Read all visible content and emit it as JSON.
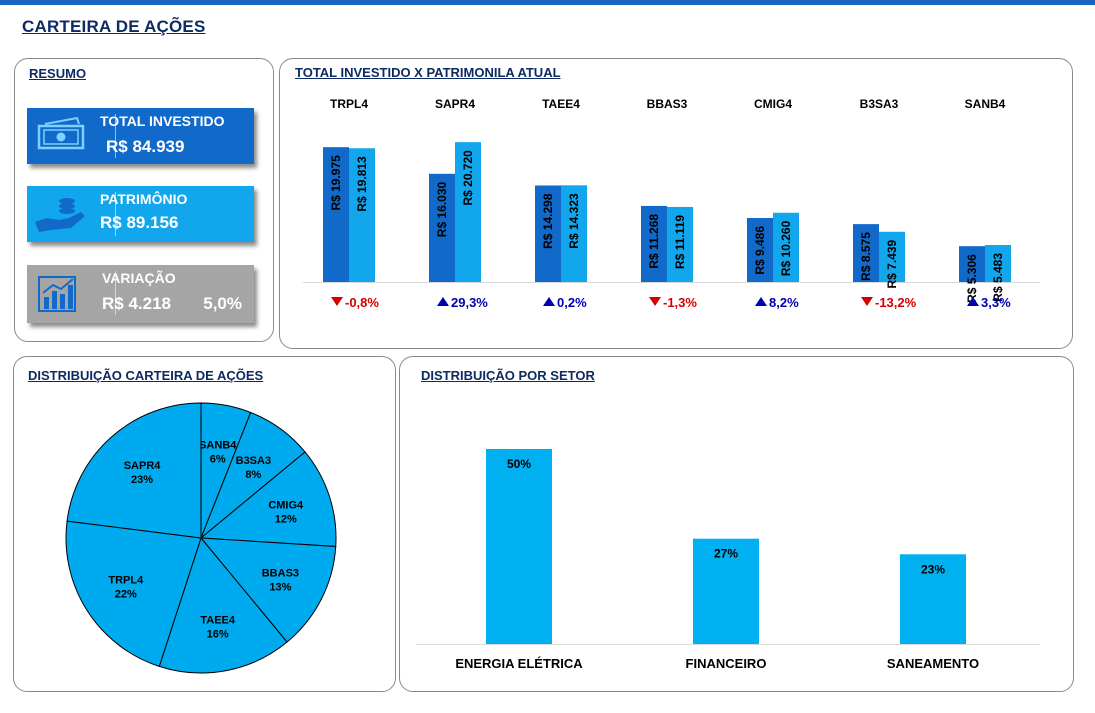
{
  "page": {
    "title": "CARTEIRA DE AÇÕES"
  },
  "resumo": {
    "title": "RESUMO",
    "cards": [
      {
        "label": "TOTAL INVESTIDO",
        "value": "R$ 84.939",
        "icon": "money-icon",
        "color": "#1169c9"
      },
      {
        "label": "PATRIMÔNIO",
        "value": "R$ 89.156",
        "icon": "hand-coins-icon",
        "color": "#12a6ec"
      },
      {
        "label": "VARIAÇÃO",
        "value": "R$ 4.218",
        "pct": "5,0%",
        "icon": "bar-chart-icon",
        "color": "#a5a5a5"
      }
    ]
  },
  "colors": {
    "invested": "#1169c9",
    "current": "#12a6ec",
    "pie": "#00aaee",
    "sector": "#00b0f0",
    "up": "#0000b0",
    "down": "#d40000",
    "title": "#0d2b63"
  },
  "chart_data": [
    {
      "type": "bar",
      "title": "TOTAL INVESTIDO X PATRIMONILA ATUAL",
      "categories": [
        "TRPL4",
        "SAPR4",
        "TAEE4",
        "BBAS3",
        "CMIG4",
        "B3SA3",
        "SANB4"
      ],
      "series": [
        {
          "values": [
            19975,
            16030,
            14298,
            11268,
            9486,
            8575,
            5306
          ]
        },
        {
          "values": [
            19813,
            20720,
            14323,
            11119,
            10260,
            7439,
            5483
          ]
        }
      ],
      "bar_labels": [
        [
          "R$ 19.975",
          "R$ 16.030",
          "R$ 14.298",
          "R$ 11.268",
          "R$ 9.486",
          "R$ 8.575",
          "R$ 5.306"
        ],
        [
          "R$ 19.813",
          "R$ 20.720",
          "R$ 14.323",
          "R$ 11.119",
          "R$ 10.260",
          "R$ 7.439",
          "R$ 5.483"
        ]
      ],
      "variations": [
        {
          "dir": "down",
          "text": "-0,8%"
        },
        {
          "dir": "up",
          "text": "29,3%"
        },
        {
          "dir": "up",
          "text": "0,2%"
        },
        {
          "dir": "down",
          "text": "-1,3%"
        },
        {
          "dir": "up",
          "text": "8,2%"
        },
        {
          "dir": "down",
          "text": "-13,2%"
        },
        {
          "dir": "up",
          "text": "3,3%"
        }
      ],
      "ylim": [
        0,
        24000
      ],
      "grid": false,
      "legend": "none"
    },
    {
      "type": "pie",
      "title": "DISTRIBUIÇÃO CARTEIRA DE AÇÕES",
      "slices": [
        {
          "label": "SANB4",
          "value": 6,
          "text": "6%"
        },
        {
          "label": "B3SA3",
          "value": 8,
          "text": "8%"
        },
        {
          "label": "CMIG4",
          "value": 12,
          "text": "12%"
        },
        {
          "label": "BBAS3",
          "value": 13,
          "text": "13%"
        },
        {
          "label": "TAEE4",
          "value": 16,
          "text": "16%"
        },
        {
          "label": "TRPL4",
          "value": 22,
          "text": "22%"
        },
        {
          "label": "SAPR4",
          "value": 23,
          "text": "23%"
        }
      ]
    },
    {
      "type": "bar",
      "title": "DISTRIBUIÇÃO POR SETOR",
      "categories": [
        "ENERGIA ELÉTRICA",
        "FINANCEIRO",
        "SANEAMENTO"
      ],
      "values": [
        50,
        27,
        23
      ],
      "value_labels": [
        "50%",
        "27%",
        "23%"
      ],
      "ylim": [
        0,
        60
      ],
      "grid": false,
      "legend": "none"
    }
  ]
}
